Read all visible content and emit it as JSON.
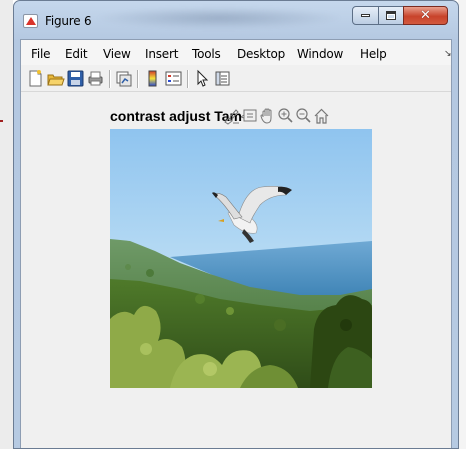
{
  "window": {
    "title": "Figure 6"
  },
  "menubar": {
    "items": [
      {
        "label": "File"
      },
      {
        "label": "Edit"
      },
      {
        "label": "View"
      },
      {
        "label": "Insert"
      },
      {
        "label": "Tools"
      },
      {
        "label": "Desktop"
      },
      {
        "label": "Window"
      },
      {
        "label": "Help"
      }
    ],
    "overflow_glyph": "↘"
  },
  "toolbar": {
    "buttons": [
      {
        "icon": "new-figure-icon"
      },
      {
        "icon": "open-file-icon"
      },
      {
        "icon": "save-icon"
      },
      {
        "icon": "print-icon"
      },
      {
        "icon": "link-plot-icon"
      },
      {
        "icon": "insert-colorbar-icon"
      },
      {
        "icon": "insert-legend-icon"
      },
      {
        "icon": "edit-plot-icon"
      },
      {
        "icon": "property-inspector-icon"
      }
    ]
  },
  "axes": {
    "title": "contrast adjust  Tam",
    "toolbar_icons": [
      "brush-icon",
      "data-tips-icon",
      "pan-icon",
      "zoom-in-icon",
      "zoom-out-icon",
      "home-icon"
    ]
  },
  "image": {
    "description_icon": "seagull-over-coastline-photo",
    "colors": {
      "sky_top": "#8fc4ef",
      "sky_bottom": "#d6ecf7",
      "sea": "#4a8fbf",
      "hills_far": "#6a8f6a",
      "vegetation_dark": "#3b5c1f",
      "vegetation_light": "#8faa48"
    }
  }
}
